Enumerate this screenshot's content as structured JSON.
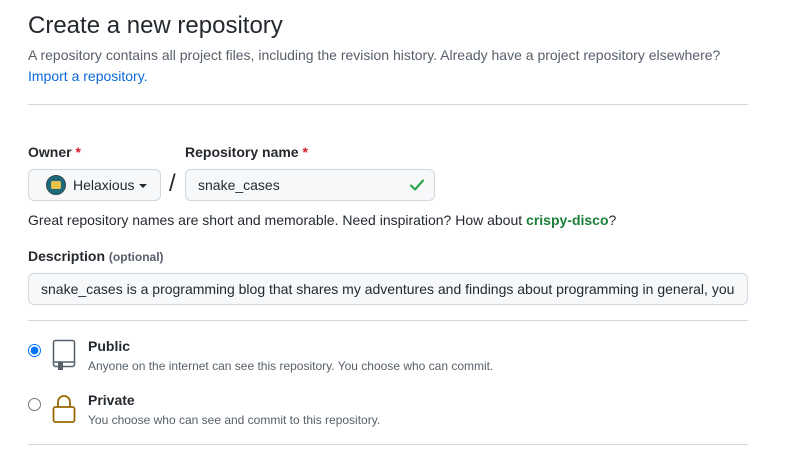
{
  "page": {
    "title": "Create a new repository",
    "intro_text": "A repository contains all project files, including the revision history. Already have a project repository elsewhere?",
    "import_link": "Import a repository."
  },
  "owner": {
    "label": "Owner",
    "required_mark": "*",
    "value": "Helaxious"
  },
  "repo_name": {
    "label": "Repository name",
    "required_mark": "*",
    "value": "snake_cases",
    "status": "valid",
    "status_icon": "check-icon",
    "status_color": "#2da44e"
  },
  "separator": "/",
  "name_hint": {
    "prefix": "Great repository names are short and memorable. Need inspiration? How about ",
    "suggestion": "crispy-disco",
    "suffix": "?"
  },
  "description": {
    "label": "Description",
    "optional_label": "(optional)",
    "value": "snake_cases is a programming blog that shares my adventures and findings about programming in general, you"
  },
  "visibility": {
    "options": [
      {
        "title": "Public",
        "note": "Anyone on the internet can see this repository. You choose who can commit.",
        "icon": "repo-book-icon",
        "selected": true
      },
      {
        "title": "Private",
        "note": "You choose who can see and commit to this repository.",
        "icon": "lock-icon",
        "selected": false
      }
    ]
  },
  "colors": {
    "link": "#0969da",
    "required": "#cf222e",
    "suggestion": "#1a7f37",
    "lock": "#9a6700",
    "border": "#d0d7de"
  }
}
